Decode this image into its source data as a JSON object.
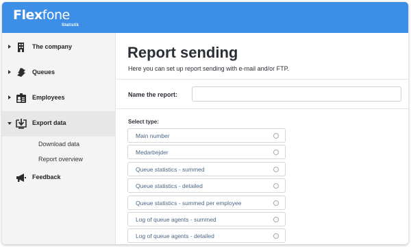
{
  "brand": {
    "logo_text": "Flexfone",
    "logo_part_bold": "Flex",
    "logo_part_regular": "fone",
    "logo_subtitle": "Statistik",
    "topbar_color": "#3d8ee6"
  },
  "sidebar": {
    "items": [
      {
        "label": "The company",
        "icon": "building-icon",
        "expanded": false,
        "active": false
      },
      {
        "label": "Queues",
        "icon": "phones-stack-icon",
        "expanded": false,
        "active": false
      },
      {
        "label": "Employees",
        "icon": "employees-icon",
        "expanded": false,
        "active": false
      },
      {
        "label": "Export data",
        "icon": "download-icon",
        "expanded": true,
        "active": true
      },
      {
        "label": "Feedback",
        "icon": "megaphone-icon",
        "expanded": false,
        "active": false
      }
    ],
    "subitems": [
      {
        "label": "Download data"
      },
      {
        "label": "Report overview"
      }
    ]
  },
  "main": {
    "title": "Report sending",
    "description": "Here you can set up report sending with e-mail and/or FTP.",
    "name_label": "Name the report:",
    "name_value": "",
    "select_label": "Select type:",
    "options": [
      {
        "label": "Main number",
        "selected": false
      },
      {
        "label": "Medarbejder",
        "selected": false
      },
      {
        "label": "Queue statistics - summed",
        "selected": false
      },
      {
        "label": "Queue statistics - detailed",
        "selected": false
      },
      {
        "label": "Queue statistics - summed per employee",
        "selected": false
      },
      {
        "label": "Log of queue agents - summed",
        "selected": false
      },
      {
        "label": "Log of queue agents - detailed",
        "selected": false
      }
    ]
  }
}
